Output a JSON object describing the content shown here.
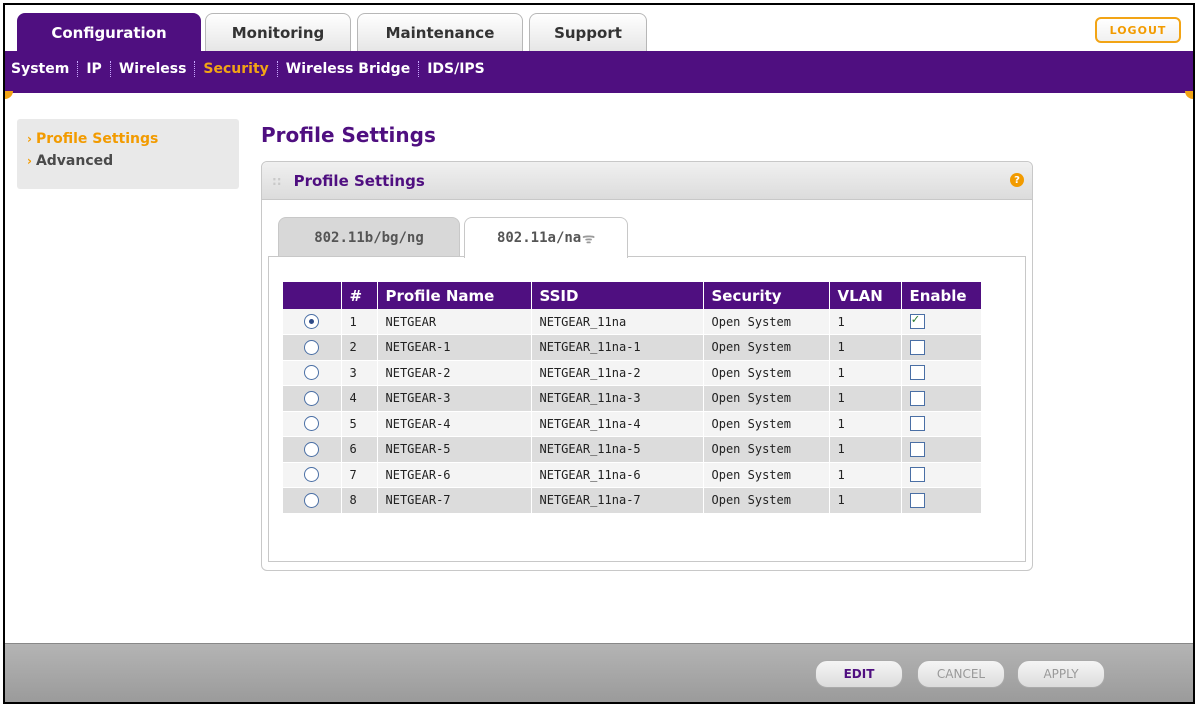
{
  "top_tabs": [
    "Configuration",
    "Monitoring",
    "Maintenance",
    "Support"
  ],
  "logout_label": "LOGOUT",
  "subnav": [
    "System",
    "IP",
    "Wireless",
    "Security",
    "Wireless Bridge",
    "IDS/IPS"
  ],
  "sidemenu": [
    "Profile Settings",
    "Advanced"
  ],
  "page_title": "Profile Settings",
  "panel_title": "Profile Settings",
  "help_icon": "?",
  "subtabs": [
    "802.11b/bg/ng",
    "802.11a/na"
  ],
  "wifi_icon_glyph": "ᯤ",
  "table": {
    "headers": [
      "",
      "#",
      "Profile Name",
      "SSID",
      "Security",
      "VLAN",
      "Enable"
    ],
    "rows": [
      {
        "num": "1",
        "name": "NETGEAR",
        "ssid": "NETGEAR_11na",
        "security": "Open System",
        "vlan": "1",
        "selected": true,
        "enabled": true
      },
      {
        "num": "2",
        "name": "NETGEAR-1",
        "ssid": "NETGEAR_11na-1",
        "security": "Open System",
        "vlan": "1",
        "selected": false,
        "enabled": false
      },
      {
        "num": "3",
        "name": "NETGEAR-2",
        "ssid": "NETGEAR_11na-2",
        "security": "Open System",
        "vlan": "1",
        "selected": false,
        "enabled": false
      },
      {
        "num": "4",
        "name": "NETGEAR-3",
        "ssid": "NETGEAR_11na-3",
        "security": "Open System",
        "vlan": "1",
        "selected": false,
        "enabled": false
      },
      {
        "num": "5",
        "name": "NETGEAR-4",
        "ssid": "NETGEAR_11na-4",
        "security": "Open System",
        "vlan": "1",
        "selected": false,
        "enabled": false
      },
      {
        "num": "6",
        "name": "NETGEAR-5",
        "ssid": "NETGEAR_11na-5",
        "security": "Open System",
        "vlan": "1",
        "selected": false,
        "enabled": false
      },
      {
        "num": "7",
        "name": "NETGEAR-6",
        "ssid": "NETGEAR_11na-6",
        "security": "Open System",
        "vlan": "1",
        "selected": false,
        "enabled": false
      },
      {
        "num": "8",
        "name": "NETGEAR-7",
        "ssid": "NETGEAR_11na-7",
        "security": "Open System",
        "vlan": "1",
        "selected": false,
        "enabled": false
      }
    ]
  },
  "buttons": {
    "edit": "EDIT",
    "cancel": "CANCEL",
    "apply": "APPLY"
  },
  "colors": {
    "brand_purple": "#4f0f80",
    "accent_orange": "#f29b00"
  }
}
